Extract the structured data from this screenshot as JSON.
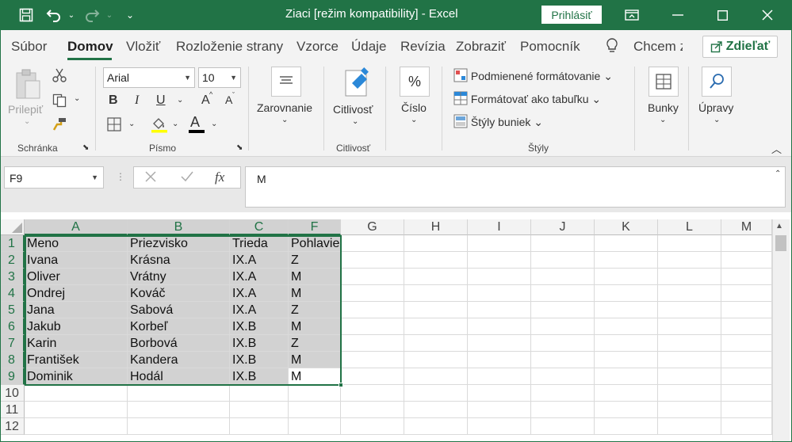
{
  "window": {
    "title": "Ziaci  [režim kompatibility]  -  Excel",
    "signin_label": "Prihlásiť",
    "save_icon": "save-icon",
    "undo_icon": "undo-icon",
    "redo_icon": "redo-icon"
  },
  "tabs": [
    {
      "label": "Súbor"
    },
    {
      "label": "Domov"
    },
    {
      "label": "Vložiť"
    },
    {
      "label": "Rozloženie strany"
    },
    {
      "label": "Vzorce"
    },
    {
      "label": "Údaje"
    },
    {
      "label": "Revízia"
    },
    {
      "label": "Zobraziť"
    },
    {
      "label": "Pomocník"
    },
    {
      "label": "Chcem z"
    }
  ],
  "share_label": "Zdieľať",
  "ribbon": {
    "clipboard": {
      "label": "Schránka",
      "paste_label": "Prilepiť"
    },
    "font": {
      "label": "Písmo",
      "font_name": "Arial",
      "font_size": "10",
      "bold": "B",
      "italic": "I",
      "underline": "U",
      "grow": "A",
      "shrink": "A",
      "color_letter": "A"
    },
    "alignment": {
      "label": "Zarovnanie"
    },
    "sensitivity": {
      "button_label": "Citlivosť",
      "group_label": "Citlivosť"
    },
    "number": {
      "label": "Číslo",
      "symbol": "%"
    },
    "styles": {
      "label": "Štýly",
      "conditional": "Podmienené formátovanie",
      "format_table": "Formátovať ako tabuľku",
      "cell_styles": "Štýly buniek"
    },
    "cells": {
      "label": "Bunky"
    },
    "editing": {
      "label": "Úpravy"
    }
  },
  "formula_bar": {
    "name_box": "F9",
    "fx": "fx",
    "value": "M"
  },
  "sheet": {
    "columns": [
      "A",
      "B",
      "C",
      "F",
      "G",
      "H",
      "I",
      "J",
      "K",
      "L",
      "M"
    ],
    "rows": [
      "1",
      "2",
      "3",
      "4",
      "5",
      "6",
      "7",
      "8",
      "9",
      "10",
      "11",
      "12"
    ],
    "data": [
      [
        "Meno",
        "Priezvisko",
        "Trieda",
        "Pohlavie"
      ],
      [
        "Ivana",
        "Krásna",
        "IX.A",
        "Z"
      ],
      [
        "Oliver",
        "Vrátny",
        "IX.A",
        "M"
      ],
      [
        "Ondrej",
        "Kováč",
        "IX.A",
        "M"
      ],
      [
        "Jana",
        "Sabová",
        "IX.A",
        "Z"
      ],
      [
        "Jakub",
        "Korbeľ",
        "IX.B",
        "M"
      ],
      [
        "Karin",
        "Borbová",
        "IX.B",
        "Z"
      ],
      [
        "František",
        "Kandera",
        "IX.B",
        "M"
      ],
      [
        "Dominik",
        "Hodál",
        "IX.B",
        "M"
      ]
    ]
  }
}
